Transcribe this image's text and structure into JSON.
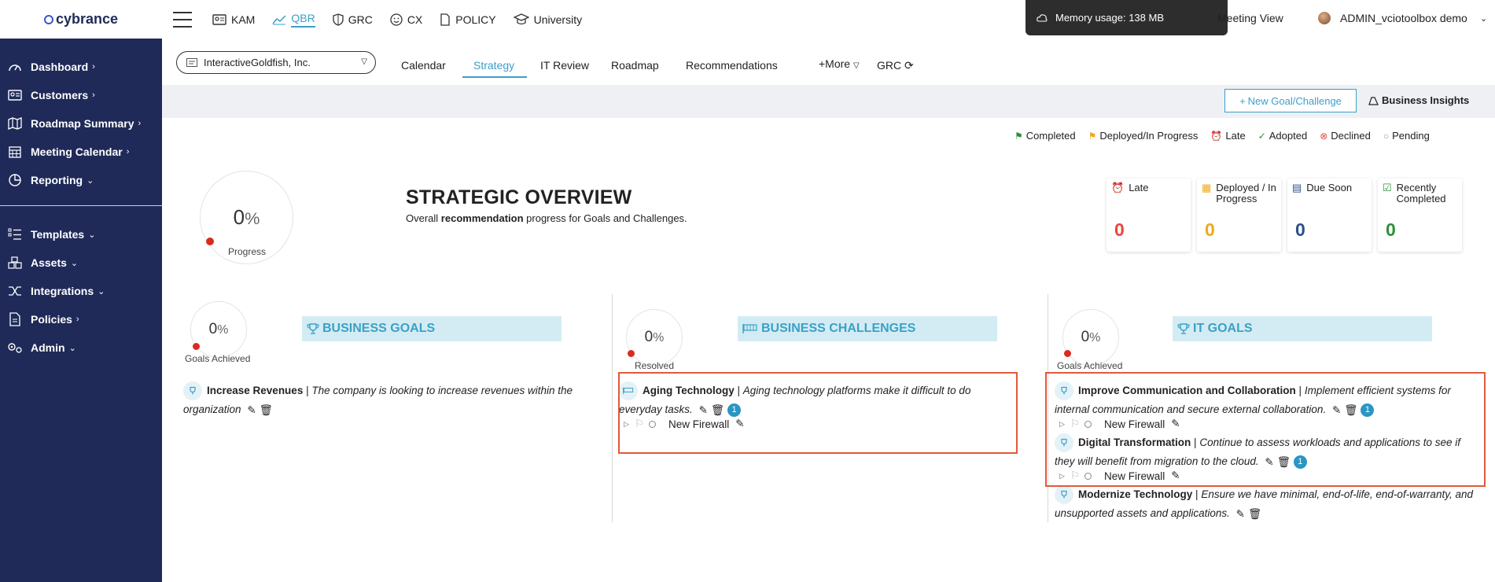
{
  "brand": "cybrance",
  "sidebar": {
    "items": [
      {
        "label": "Dashboard",
        "chev": "›"
      },
      {
        "label": "Customers",
        "chev": "›"
      },
      {
        "label": "Roadmap Summary",
        "chev": "›"
      },
      {
        "label": "Meeting Calendar",
        "chev": "›"
      },
      {
        "label": "Reporting",
        "chev": "⌄"
      },
      {
        "label": "Templates",
        "chev": "⌄"
      },
      {
        "label": "Assets",
        "chev": "⌄"
      },
      {
        "label": "Integrations",
        "chev": "⌄"
      },
      {
        "label": "Policies",
        "chev": "›"
      },
      {
        "label": "Admin",
        "chev": "⌄"
      }
    ]
  },
  "topnav": {
    "tabs": [
      "KAM",
      "QBR",
      "GRC",
      "CX",
      "POLICY",
      "University"
    ],
    "active": "QBR",
    "memory": "Memory usage: 138 MB",
    "meeting_view": "Meeting View",
    "user": "ADMIN_vciotoolbox demo"
  },
  "subnav": {
    "customer": "InteractiveGoldfish, Inc.",
    "tabs": [
      "Calendar",
      "Strategy",
      "IT Review",
      "Roadmap",
      "Recommendations",
      "+More",
      "GRC"
    ],
    "active": "Strategy"
  },
  "actions": {
    "new_goal": "New Goal/Challenge",
    "insights": "Business Insights"
  },
  "legend": [
    "Completed",
    "Deployed/In Progress",
    "Late",
    "Adopted",
    "Declined",
    "Pending"
  ],
  "overview": {
    "progress_value": "0",
    "pct_sign": "%",
    "progress_label": "Progress",
    "title": "STRATEGIC OVERVIEW",
    "subtitle_pre": "Overall ",
    "subtitle_bold": "recommendation",
    "subtitle_post": " progress for Goals and Challenges.",
    "stats": [
      {
        "label": "Late",
        "value": "0",
        "color": "#e8483a"
      },
      {
        "label": "Deployed / In Progress",
        "value": "0",
        "color": "#f0a91a"
      },
      {
        "label": "Due Soon",
        "value": "0",
        "color": "#2e4f8a"
      },
      {
        "label": "Recently Completed",
        "value": "0",
        "color": "#2f8f3a"
      }
    ]
  },
  "columns": [
    {
      "header": "BUSINESS GOALS",
      "value": "0",
      "caption": "Goals Achieved",
      "entries": [
        {
          "title": "Increase Revenues",
          "desc": "The company is looking to increase revenues within the organization"
        }
      ]
    },
    {
      "header": "BUSINESS CHALLENGES",
      "value": "0",
      "caption": "Resolved",
      "entries": [
        {
          "title": "Aging Technology",
          "desc": "Aging technology platforms make it difficult to do everyday tasks.",
          "badge": "1",
          "sub": "New Firewall"
        }
      ]
    },
    {
      "header": "IT GOALS",
      "value": "0",
      "caption": "Goals Achieved",
      "entries": [
        {
          "title": "Improve Communication and Collaboration",
          "desc": "Implement efficient systems for internal communication and secure external collaboration.",
          "badge": "1",
          "sub": "New Firewall"
        },
        {
          "title": "Digital Transformation",
          "desc": "Continue to assess workloads and applications to see if they will benefit from migration to the cloud.",
          "badge": "1",
          "sub": "New Firewall"
        },
        {
          "title": "Modernize Technology",
          "desc": "Ensure we have minimal, end-of-life, end-of-warranty, and unsupported assets and applications."
        }
      ]
    }
  ],
  "separator": "|"
}
